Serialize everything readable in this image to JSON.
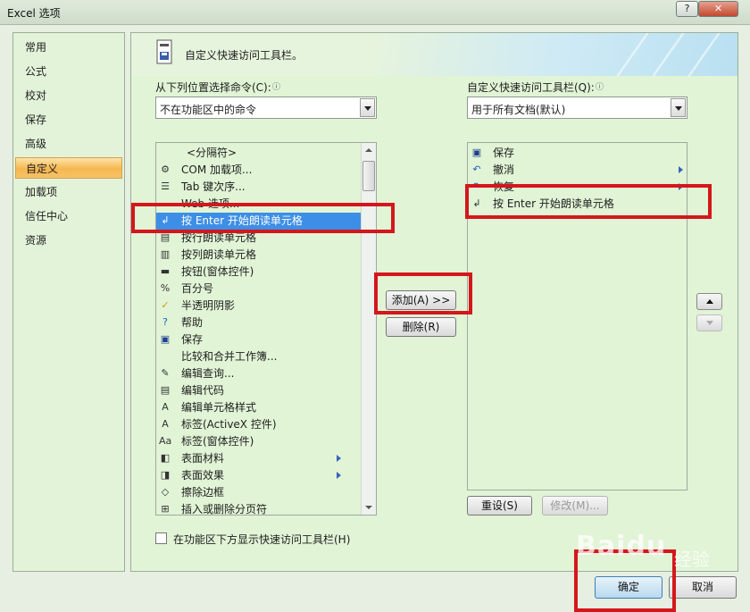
{
  "window": {
    "title": "Excel 选项",
    "help_glyph": "?",
    "close_glyph": "✕"
  },
  "nav": {
    "items": [
      {
        "label": "常用"
      },
      {
        "label": "公式"
      },
      {
        "label": "校对"
      },
      {
        "label": "保存"
      },
      {
        "label": "高级"
      },
      {
        "label": "自定义",
        "selected": true
      },
      {
        "label": "加载项"
      },
      {
        "label": "信任中心"
      },
      {
        "label": "资源"
      }
    ]
  },
  "header": {
    "title": "自定义快速访问工具栏。"
  },
  "left_panel": {
    "choose_label": "从下列位置选择命令(C):",
    "choose_value": "不在功能区中的命令",
    "commands": [
      {
        "icon": "",
        "label": "<分隔符>"
      },
      {
        "icon": "com-addins-icon",
        "label": "COM 加载项..."
      },
      {
        "icon": "tab-order-icon",
        "label": "Tab 键次序..."
      },
      {
        "icon": "",
        "label": "Web 选项..."
      },
      {
        "icon": "speak-on-enter-icon",
        "label": "按 Enter 开始朗读单元格",
        "selected": true
      },
      {
        "icon": "speak-by-rows-icon",
        "label": "按行朗读单元格"
      },
      {
        "icon": "speak-by-columns-icon",
        "label": "按列朗读单元格"
      },
      {
        "icon": "form-button-icon",
        "label": "按钮(窗体控件)"
      },
      {
        "icon": "percent-icon",
        "label": "百分号"
      },
      {
        "icon": "checkmark-icon",
        "label": "半透明阴影"
      },
      {
        "icon": "help-icon",
        "label": "帮助"
      },
      {
        "icon": "save-icon",
        "label": "保存"
      },
      {
        "icon": "",
        "label": "比较和合并工作簿..."
      },
      {
        "icon": "edit-query-icon",
        "label": "编辑查询..."
      },
      {
        "icon": "edit-code-icon",
        "label": "编辑代码"
      },
      {
        "icon": "cell-style-icon",
        "label": "编辑单元格样式"
      },
      {
        "icon": "label-activex-icon",
        "label": "标签(ActiveX 控件)"
      },
      {
        "icon": "label-form-icon",
        "label": "标签(窗体控件)"
      },
      {
        "icon": "surface-material-icon",
        "label": "表面材料",
        "submenu": true
      },
      {
        "icon": "surface-effect-icon",
        "label": "表面效果",
        "submenu": true
      },
      {
        "icon": "eraser-icon",
        "label": "擦除边框"
      },
      {
        "icon": "page-break-icon",
        "label": "插入或删除分页符"
      }
    ],
    "show_below_label": "在功能区下方显示快速访问工具栏(H)"
  },
  "middle": {
    "add_label": "添加(A) >>",
    "remove_label": "删除(R)"
  },
  "right_panel": {
    "customize_label": "自定义快速访问工具栏(Q):",
    "customize_value": "用于所有文档(默认)",
    "items": [
      {
        "icon": "save-icon",
        "label": "保存"
      },
      {
        "icon": "undo-icon",
        "label": "撤消",
        "submenu": true
      },
      {
        "icon": "redo-icon",
        "label": "恢复",
        "submenu": true
      },
      {
        "icon": "speak-on-enter-icon",
        "label": "按 Enter 开始朗读单元格"
      }
    ],
    "reset_label": "重设(S)",
    "modify_label": "修改(M)..."
  },
  "footer": {
    "ok_label": "确定",
    "cancel_label": "取消"
  },
  "watermark": {
    "brand": "Baidu",
    "suffix": "经验"
  },
  "colors": {
    "highlight_red": "#d4171c",
    "selection_blue": "#3d8ee6",
    "nav_selected": "#f6b64f"
  }
}
